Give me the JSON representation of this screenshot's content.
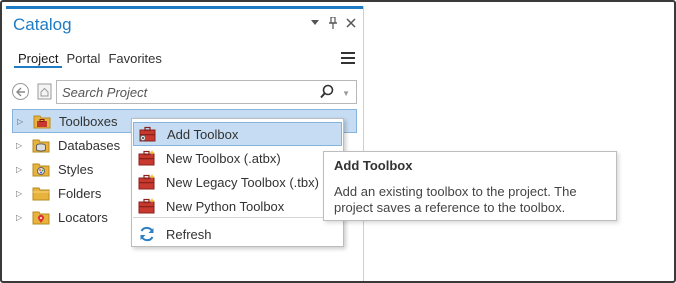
{
  "catalog": {
    "title": "Catalog",
    "controls": {
      "menu_icon": "chevron-down-icon",
      "pin_icon": "pin-icon",
      "close_icon": "close-icon"
    },
    "tabs": [
      {
        "label": "Project",
        "active": true
      },
      {
        "label": "Portal",
        "active": false
      },
      {
        "label": "Favorites",
        "active": false
      }
    ],
    "search": {
      "placeholder": "Search Project"
    },
    "tree": [
      {
        "label": "Toolboxes",
        "icon": "toolbox-folder-icon",
        "selected": true
      },
      {
        "label": "Databases",
        "icon": "database-folder-icon",
        "selected": false
      },
      {
        "label": "Styles",
        "icon": "styles-folder-icon",
        "selected": false
      },
      {
        "label": "Folders",
        "icon": "folder-icon",
        "selected": false
      },
      {
        "label": "Locators",
        "icon": "locators-folder-icon",
        "selected": false
      }
    ]
  },
  "context_menu": {
    "items": [
      {
        "label": "Add Toolbox",
        "icon": "add-toolbox-icon",
        "hover": true
      },
      {
        "label": "New Toolbox (.atbx)",
        "icon": "new-toolbox-icon"
      },
      {
        "label": "New Legacy Toolbox (.tbx)",
        "icon": "new-legacy-toolbox-icon"
      },
      {
        "label": "New Python Toolbox",
        "icon": "new-python-toolbox-icon"
      },
      {
        "label": "Refresh",
        "icon": "refresh-icon"
      }
    ]
  },
  "tooltip": {
    "title": "Add Toolbox",
    "body": "Add an existing toolbox to the project. The project saves a reference to the toolbox."
  },
  "colors": {
    "accent": "#1e7bc4",
    "selection": "#c5dcf2",
    "toolbox_red": "#c8382e",
    "folder_yellow": "#e8b33c"
  }
}
